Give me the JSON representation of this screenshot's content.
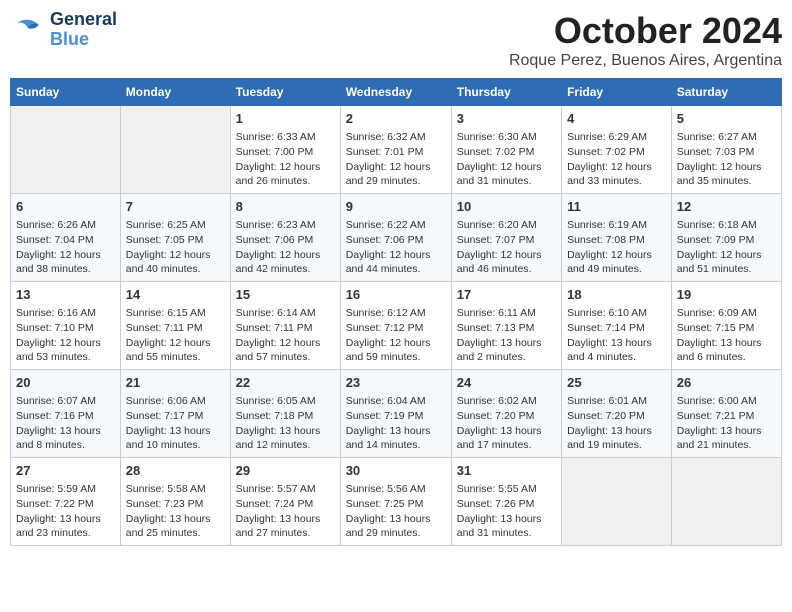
{
  "header": {
    "logo_line1": "General",
    "logo_line2": "Blue",
    "month_title": "October 2024",
    "subtitle": "Roque Perez, Buenos Aires, Argentina"
  },
  "days_of_week": [
    "Sunday",
    "Monday",
    "Tuesday",
    "Wednesday",
    "Thursday",
    "Friday",
    "Saturday"
  ],
  "weeks": [
    [
      {
        "day": "",
        "info": ""
      },
      {
        "day": "",
        "info": ""
      },
      {
        "day": "1",
        "info": "Sunrise: 6:33 AM\nSunset: 7:00 PM\nDaylight: 12 hours\nand 26 minutes."
      },
      {
        "day": "2",
        "info": "Sunrise: 6:32 AM\nSunset: 7:01 PM\nDaylight: 12 hours\nand 29 minutes."
      },
      {
        "day": "3",
        "info": "Sunrise: 6:30 AM\nSunset: 7:02 PM\nDaylight: 12 hours\nand 31 minutes."
      },
      {
        "day": "4",
        "info": "Sunrise: 6:29 AM\nSunset: 7:02 PM\nDaylight: 12 hours\nand 33 minutes."
      },
      {
        "day": "5",
        "info": "Sunrise: 6:27 AM\nSunset: 7:03 PM\nDaylight: 12 hours\nand 35 minutes."
      }
    ],
    [
      {
        "day": "6",
        "info": "Sunrise: 6:26 AM\nSunset: 7:04 PM\nDaylight: 12 hours\nand 38 minutes."
      },
      {
        "day": "7",
        "info": "Sunrise: 6:25 AM\nSunset: 7:05 PM\nDaylight: 12 hours\nand 40 minutes."
      },
      {
        "day": "8",
        "info": "Sunrise: 6:23 AM\nSunset: 7:06 PM\nDaylight: 12 hours\nand 42 minutes."
      },
      {
        "day": "9",
        "info": "Sunrise: 6:22 AM\nSunset: 7:06 PM\nDaylight: 12 hours\nand 44 minutes."
      },
      {
        "day": "10",
        "info": "Sunrise: 6:20 AM\nSunset: 7:07 PM\nDaylight: 12 hours\nand 46 minutes."
      },
      {
        "day": "11",
        "info": "Sunrise: 6:19 AM\nSunset: 7:08 PM\nDaylight: 12 hours\nand 49 minutes."
      },
      {
        "day": "12",
        "info": "Sunrise: 6:18 AM\nSunset: 7:09 PM\nDaylight: 12 hours\nand 51 minutes."
      }
    ],
    [
      {
        "day": "13",
        "info": "Sunrise: 6:16 AM\nSunset: 7:10 PM\nDaylight: 12 hours\nand 53 minutes."
      },
      {
        "day": "14",
        "info": "Sunrise: 6:15 AM\nSunset: 7:11 PM\nDaylight: 12 hours\nand 55 minutes."
      },
      {
        "day": "15",
        "info": "Sunrise: 6:14 AM\nSunset: 7:11 PM\nDaylight: 12 hours\nand 57 minutes."
      },
      {
        "day": "16",
        "info": "Sunrise: 6:12 AM\nSunset: 7:12 PM\nDaylight: 12 hours\nand 59 minutes."
      },
      {
        "day": "17",
        "info": "Sunrise: 6:11 AM\nSunset: 7:13 PM\nDaylight: 13 hours\nand 2 minutes."
      },
      {
        "day": "18",
        "info": "Sunrise: 6:10 AM\nSunset: 7:14 PM\nDaylight: 13 hours\nand 4 minutes."
      },
      {
        "day": "19",
        "info": "Sunrise: 6:09 AM\nSunset: 7:15 PM\nDaylight: 13 hours\nand 6 minutes."
      }
    ],
    [
      {
        "day": "20",
        "info": "Sunrise: 6:07 AM\nSunset: 7:16 PM\nDaylight: 13 hours\nand 8 minutes."
      },
      {
        "day": "21",
        "info": "Sunrise: 6:06 AM\nSunset: 7:17 PM\nDaylight: 13 hours\nand 10 minutes."
      },
      {
        "day": "22",
        "info": "Sunrise: 6:05 AM\nSunset: 7:18 PM\nDaylight: 13 hours\nand 12 minutes."
      },
      {
        "day": "23",
        "info": "Sunrise: 6:04 AM\nSunset: 7:19 PM\nDaylight: 13 hours\nand 14 minutes."
      },
      {
        "day": "24",
        "info": "Sunrise: 6:02 AM\nSunset: 7:20 PM\nDaylight: 13 hours\nand 17 minutes."
      },
      {
        "day": "25",
        "info": "Sunrise: 6:01 AM\nSunset: 7:20 PM\nDaylight: 13 hours\nand 19 minutes."
      },
      {
        "day": "26",
        "info": "Sunrise: 6:00 AM\nSunset: 7:21 PM\nDaylight: 13 hours\nand 21 minutes."
      }
    ],
    [
      {
        "day": "27",
        "info": "Sunrise: 5:59 AM\nSunset: 7:22 PM\nDaylight: 13 hours\nand 23 minutes."
      },
      {
        "day": "28",
        "info": "Sunrise: 5:58 AM\nSunset: 7:23 PM\nDaylight: 13 hours\nand 25 minutes."
      },
      {
        "day": "29",
        "info": "Sunrise: 5:57 AM\nSunset: 7:24 PM\nDaylight: 13 hours\nand 27 minutes."
      },
      {
        "day": "30",
        "info": "Sunrise: 5:56 AM\nSunset: 7:25 PM\nDaylight: 13 hours\nand 29 minutes."
      },
      {
        "day": "31",
        "info": "Sunrise: 5:55 AM\nSunset: 7:26 PM\nDaylight: 13 hours\nand 31 minutes."
      },
      {
        "day": "",
        "info": ""
      },
      {
        "day": "",
        "info": ""
      }
    ]
  ]
}
